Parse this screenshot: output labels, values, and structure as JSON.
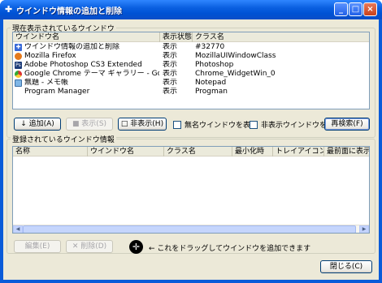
{
  "window": {
    "title": "ウインドウ情報の追加と削除",
    "title_icon": "arrow-icon",
    "controls": {
      "minimize": "_",
      "maximize": "□",
      "close": "×"
    }
  },
  "current_group": {
    "label": "現在表示されているウインドウ",
    "columns": [
      "ウインドウ名",
      "表示状態",
      "クラス名"
    ],
    "rows": [
      {
        "icon": "app-window-icon",
        "name": "ウインドウ情報の追加と削除",
        "state": "表示",
        "class": "#32770"
      },
      {
        "icon": "firefox-icon",
        "name": "Mozilla Firefox",
        "state": "表示",
        "class": "MozillaUIWindowClass"
      },
      {
        "icon": "photoshop-icon",
        "name": "Adobe Photoshop CS3 Extended",
        "state": "表示",
        "class": "Photoshop"
      },
      {
        "icon": "chrome-icon",
        "name": "Google Chrome テーマ ギャラリー - Google Chrome",
        "state": "表示",
        "class": "Chrome_WidgetWin_0"
      },
      {
        "icon": "notepad-icon",
        "name": "無題 - メモ帳",
        "state": "表示",
        "class": "Notepad"
      },
      {
        "icon": "",
        "name": "Program Manager",
        "state": "表示",
        "class": "Progman"
      }
    ],
    "buttons": {
      "add": "↓ 追加(A)",
      "show": "■ 表示(S)",
      "hide": "□ 非表示(H)",
      "research": "再検索(F)"
    },
    "checkboxes": {
      "unnamed": "無名ウインドウを表示",
      "hidden": "非表示ウインドウを表示"
    }
  },
  "registered_group": {
    "label": "登録されているウインドウ情報",
    "columns": [
      "名称",
      "ウインドウ名",
      "クラス名",
      "最小化時",
      "トレイアイコン",
      "最前面に表示"
    ],
    "rows": []
  },
  "bottom": {
    "edit": "編集(E)",
    "delete": "✕ 削除(D)",
    "drag_hint": "← これをドラッグしてウインドウを追加できます",
    "close": "閉じる(C)"
  },
  "colors": {
    "titlebar": "#0a5fe0",
    "face": "#ece9d8",
    "listview_border": "#7f9db9"
  }
}
